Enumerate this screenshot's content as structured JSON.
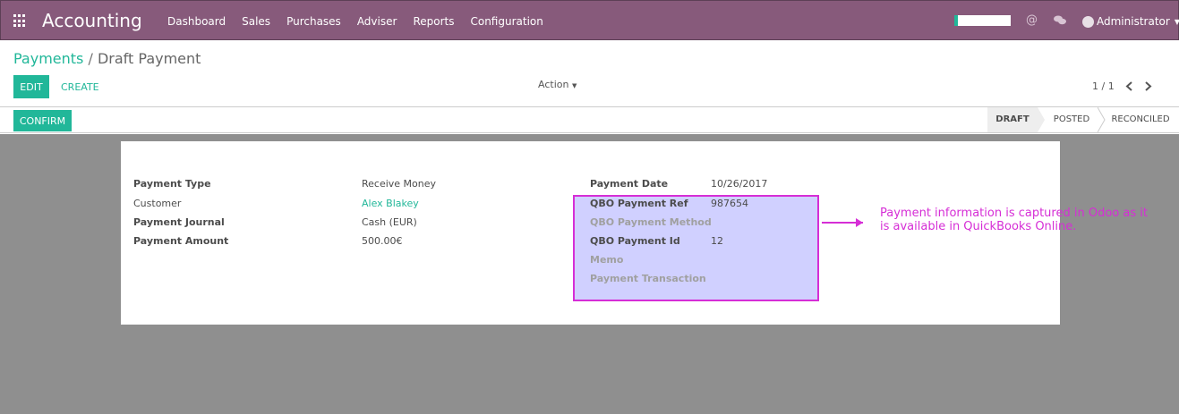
{
  "app": {
    "title": "Accounting"
  },
  "menu": [
    "Dashboard",
    "Sales",
    "Purchases",
    "Adviser",
    "Reports",
    "Configuration"
  ],
  "user": {
    "name": "Administrator"
  },
  "breadcrumb": {
    "parent": "Payments",
    "separator": "/",
    "current": "Draft Payment"
  },
  "toolbar": {
    "edit_label": "EDIT",
    "create_label": "CREATE",
    "action_label": "Action",
    "pager": "1 / 1"
  },
  "statusbar": {
    "confirm_label": "CONFIRM",
    "stages": [
      "DRAFT",
      "POSTED",
      "RECONCILED"
    ],
    "active_stage": "DRAFT"
  },
  "form": {
    "payment_type_label": "Payment Type",
    "payment_type": "Receive Money",
    "customer_label": "Customer",
    "customer": "Alex Blakey",
    "journal_label": "Payment Journal",
    "journal": "Cash (EUR)",
    "amount_label": "Payment Amount",
    "amount": "500.00€",
    "date_label": "Payment Date",
    "date": "10/26/2017",
    "qbo_ref_label": "QBO Payment Ref",
    "qbo_ref": "987654",
    "qbo_method_label": "QBO Payment Method",
    "qbo_id_label": "QBO Payment Id",
    "qbo_id": "12",
    "memo_label": "Memo",
    "transaction_label": "Payment Transaction"
  },
  "annotation": {
    "text": "Payment information is captured in Odoo as it is available in QuickBooks Online."
  },
  "colors": {
    "brand": "#875a7b",
    "accent": "#21b799",
    "annotation": "#d62ed6"
  }
}
